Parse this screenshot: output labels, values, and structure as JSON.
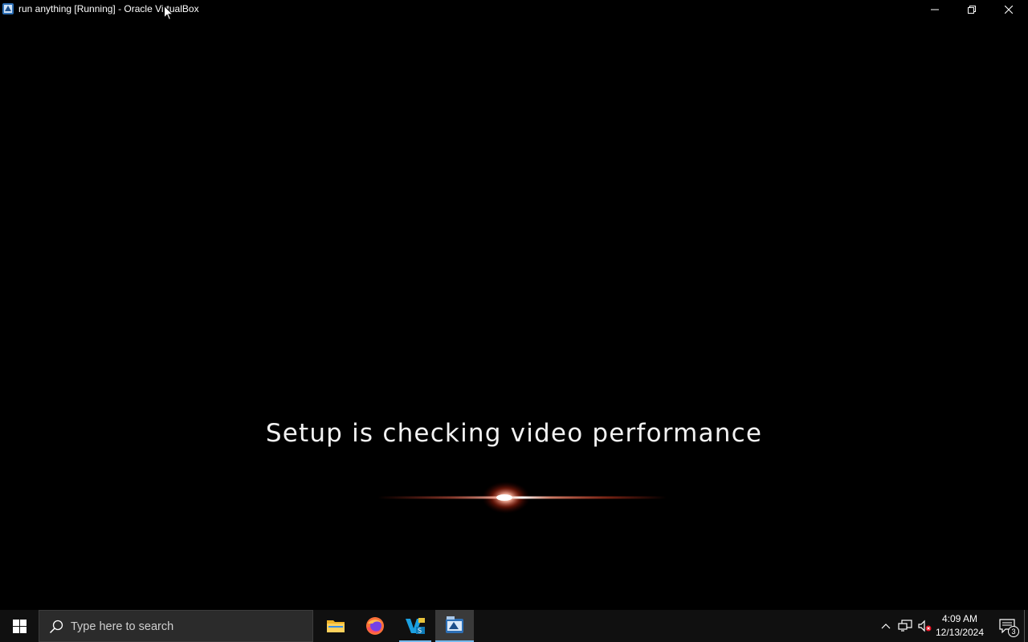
{
  "window": {
    "title": "run anything [Running] - Oracle VirtualBox",
    "buttons": {
      "minimize": "minimize-icon",
      "maximize": "restore-icon",
      "close": "close-icon"
    }
  },
  "vm": {
    "message": "Setup is checking video performance",
    "glow_colors": {
      "core": "#ffffff",
      "halo": "#ff4a2a"
    }
  },
  "taskbar": {
    "search_placeholder": "Type here to search",
    "apps": [
      {
        "name": "File Explorer",
        "icon": "folder-icon"
      },
      {
        "name": "Firefox",
        "icon": "firefox-icon"
      },
      {
        "name": "VS",
        "icon": "visual-studio-icon"
      },
      {
        "name": "VirtualBox",
        "icon": "virtualbox-icon"
      }
    ],
    "tray": {
      "chevron": "chevron-up-icon",
      "network": "network-icon",
      "volume": "volume-muted-icon"
    },
    "clock": {
      "time": "4:09 AM",
      "date": "12/13/2024"
    },
    "notifications": {
      "count": "3"
    },
    "accent": "#76b9ed"
  }
}
